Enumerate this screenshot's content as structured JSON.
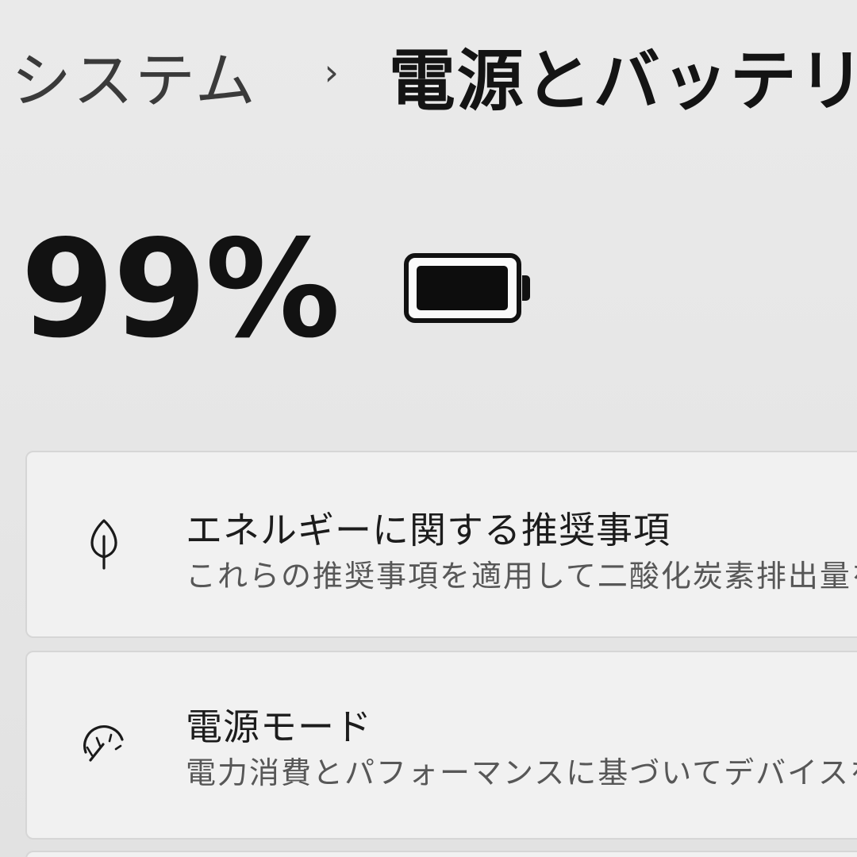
{
  "header": {
    "breadcrumb_parent": "システム",
    "breadcrumb_separator": "›",
    "page_title": "電源とバッテリー"
  },
  "battery": {
    "percent_text": "99%",
    "level": 0.99,
    "icon": "battery-full-icon"
  },
  "cards": [
    {
      "icon": "leaf-icon",
      "title": "エネルギーに関する推奨事項",
      "description": "これらの推奨事項を適用して二酸化炭素排出量を削"
    },
    {
      "icon": "gauge-icon",
      "title": "電源モード",
      "description": "電力消費とパフォーマンスに基づいてデバイスを最適化"
    }
  ]
}
